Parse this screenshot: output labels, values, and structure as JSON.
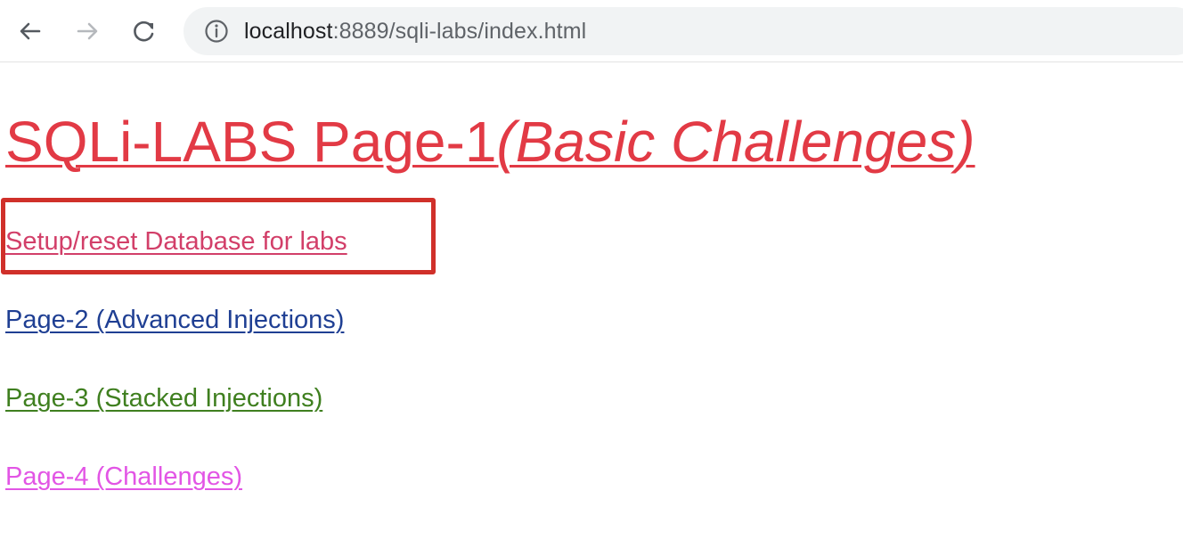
{
  "browser": {
    "url_host": "localhost",
    "url_path": ":8889/sqli-labs/index.html",
    "icons": [
      "back-arrow-icon",
      "forward-arrow-icon",
      "reload-icon",
      "info-icon"
    ]
  },
  "page": {
    "title_main": "SQLi-LABS Page-1",
    "title_italic": "(Basic Challenges)",
    "links": {
      "setup": "Setup/reset Database for labs",
      "page2": "Page-2 (Advanced Injections)",
      "page3": "Page-3 (Stacked Injections)",
      "page4": "Page-4 (Challenges)"
    }
  },
  "colors": {
    "title": "#e23a45",
    "setup_link": "#d23f69",
    "page2_link": "#1f3f93",
    "page3_link": "#3f7f1f",
    "page4_link": "#e255e5",
    "annotation_box": "#d0302a"
  }
}
